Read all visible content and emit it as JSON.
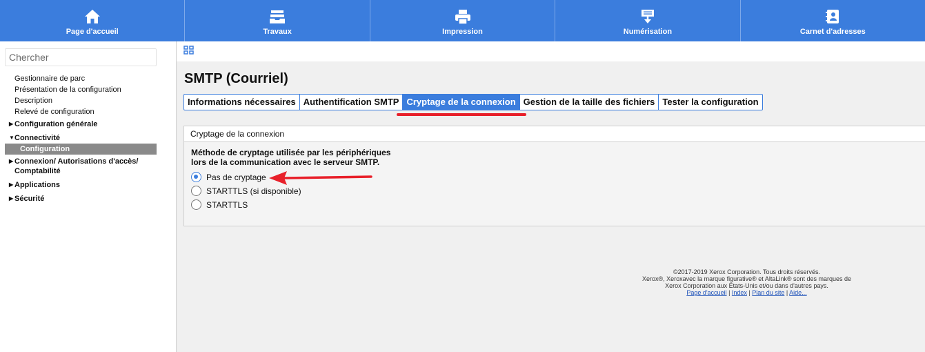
{
  "topnav": {
    "items": [
      {
        "label": "Page d'accueil",
        "icon": "home-icon"
      },
      {
        "label": "Travaux",
        "icon": "jobs-tray-icon"
      },
      {
        "label": "Impression",
        "icon": "printer-icon"
      },
      {
        "label": "Numérisation",
        "icon": "scanner-icon"
      },
      {
        "label": "Carnet d'adresses",
        "icon": "address-book-icon"
      }
    ]
  },
  "sidebar": {
    "search_placeholder": "Chercher",
    "items": [
      "Gestionnaire de parc",
      "Présentation de la configuration",
      "Description",
      "Relevé de configuration"
    ],
    "cat_config_generale": "Configuration générale",
    "cat_connectivite": "Connectivité",
    "active_item": "Configuration",
    "cat_connexion_line1": "Connexion/ Autorisations d'accès/",
    "cat_connexion_line2": "Comptabilité",
    "cat_applications": "Applications",
    "cat_securite": "Sécurité"
  },
  "main": {
    "title": "SMTP (Courriel)",
    "tabs": [
      "Informations nécessaires",
      "Authentification SMTP",
      "Cryptage de la connexion",
      "Gestion de la taille des fichiers",
      "Tester la configuration"
    ],
    "active_tab": "Cryptage de la connexion",
    "panel_title": "Cryptage de la connexion",
    "description_line1": "Méthode de cryptage utilisée par les périphériques",
    "description_line2": "lors de la communication avec le serveur SMTP.",
    "options": [
      "Pas de cryptage",
      "STARTTLS (si disponible)",
      "STARTTLS"
    ],
    "selected_option": "Pas de cryptage"
  },
  "footer": {
    "line1": "©2017-2019  Xerox Corporation. Tous droits réservés.",
    "line2": "Xerox®, Xeroxavec la marque figurative® et AltaLink® sont des marques de",
    "line3": "Xerox Corporation aux États-Unis et/ou dans d'autres pays.",
    "links": [
      "Page d'accueil",
      "Index",
      "Plan du site",
      "Aide..."
    ]
  },
  "colors": {
    "accent": "#3b7ddd",
    "annotation_red": "#e8202a"
  }
}
